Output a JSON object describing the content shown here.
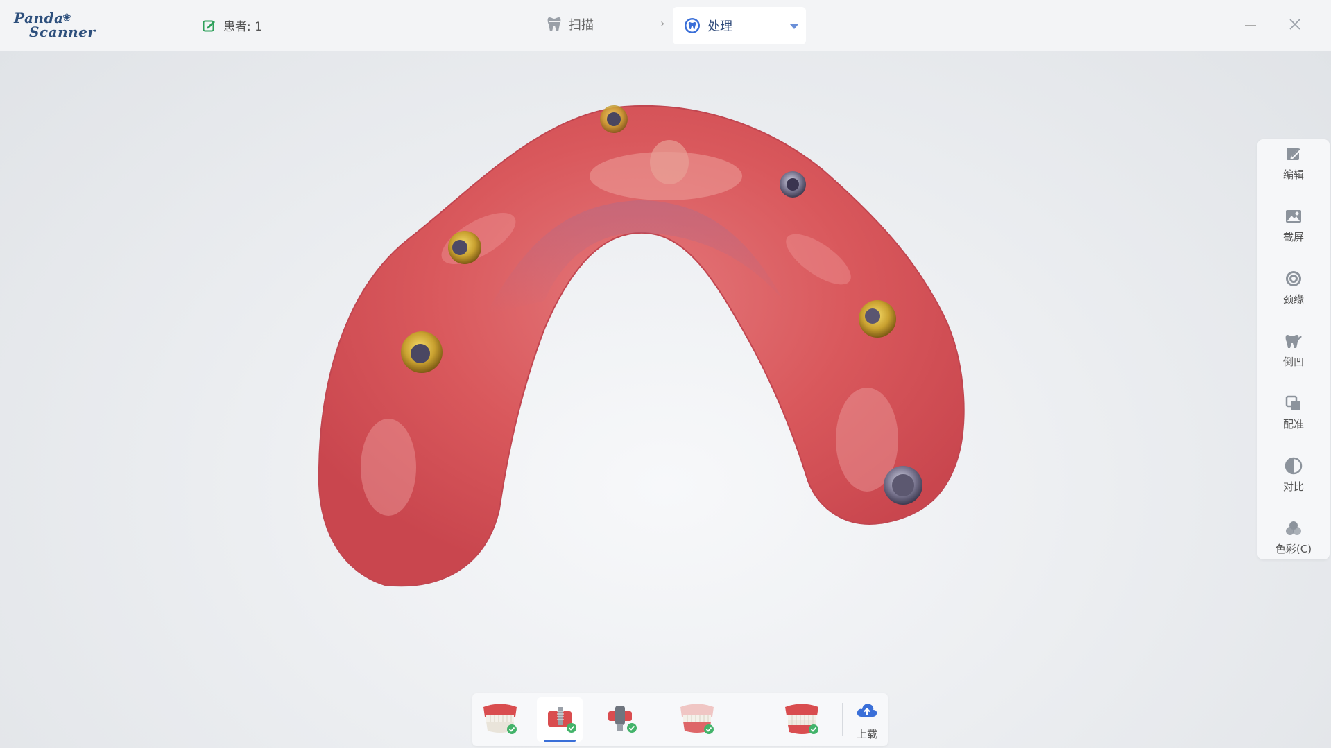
{
  "app": {
    "logo_line1": "Panda",
    "logo_line2": "Scanner",
    "patient_label": "患者: 1"
  },
  "workflow": {
    "steps": [
      {
        "label": "扫描",
        "icon": "tooth-icon",
        "active": false
      },
      {
        "label": "处理",
        "icon": "tooth-shield-icon",
        "active": true
      }
    ]
  },
  "side_tools": [
    {
      "label": "编辑",
      "icon": "edit-icon"
    },
    {
      "label": "截屏",
      "icon": "screenshot-icon"
    },
    {
      "label": "颈缘",
      "icon": "margin-line-icon"
    },
    {
      "label": "倒凹",
      "icon": "undercut-icon"
    },
    {
      "label": "配准",
      "icon": "registration-icon"
    },
    {
      "label": "对比",
      "icon": "contrast-icon"
    },
    {
      "label": "色彩(C)",
      "icon": "color-icon"
    }
  ],
  "bottom_tools": {
    "items": [
      {
        "name": "upper-jaw-scan",
        "icon": "jaw-model-icon",
        "completed": true,
        "active": false
      },
      {
        "name": "implant-scan-body",
        "icon": "implant-scan-icon",
        "completed": true,
        "active": true
      },
      {
        "name": "scan-body-detail",
        "icon": "scan-body-icon",
        "completed": true,
        "active": false
      },
      {
        "name": "gingiva-scan",
        "icon": "gingiva-model-icon",
        "completed": true,
        "active": false
      },
      {
        "name": "bite-scan",
        "icon": "bite-model-icon",
        "completed": true,
        "active": false
      }
    ],
    "upload_label": "上载"
  },
  "colors": {
    "accent": "#3a6fd8",
    "check_green": "#43b36a",
    "gum_red": "#d94d4f",
    "logo_navy": "#2d4f7c"
  }
}
